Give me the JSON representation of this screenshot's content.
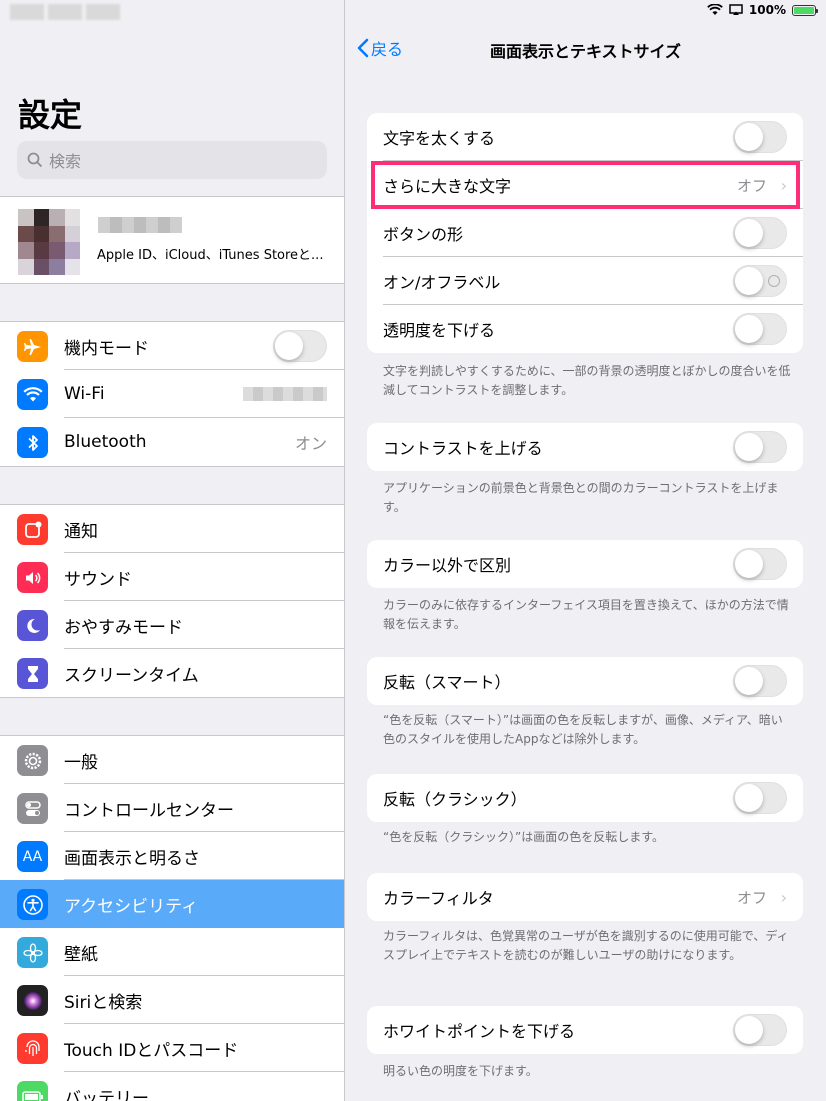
{
  "status": {
    "battery": "100%"
  },
  "sidebar": {
    "title": "設定",
    "search_placeholder": "検索",
    "profile_sub": "Apple ID、iCloud、iTunes Storeと...",
    "group1": [
      {
        "label": "機内モード",
        "icon": "airplane-icon",
        "color": "#ff9500",
        "type": "toggle"
      },
      {
        "label": "Wi-Fi",
        "icon": "wifi-icon",
        "color": "#007aff",
        "type": "blur"
      },
      {
        "label": "Bluetooth",
        "icon": "bluetooth-icon",
        "color": "#007aff",
        "value": "オン"
      }
    ],
    "group2": [
      {
        "label": "通知",
        "icon": "notification-icon",
        "color": "#ff3b30"
      },
      {
        "label": "サウンド",
        "icon": "speaker-icon",
        "color": "#ff2d55"
      },
      {
        "label": "おやすみモード",
        "icon": "moon-icon",
        "color": "#5856d6"
      },
      {
        "label": "スクリーンタイム",
        "icon": "hourglass-icon",
        "color": "#5856d6"
      }
    ],
    "group3": [
      {
        "label": "一般",
        "icon": "gear-icon",
        "color": "#8e8e93"
      },
      {
        "label": "コントロールセンター",
        "icon": "switches-icon",
        "color": "#8e8e93"
      },
      {
        "label": "画面表示と明るさ",
        "icon": "text-size-icon",
        "color": "#007aff"
      },
      {
        "label": "アクセシビリティ",
        "icon": "accessibility-icon",
        "color": "#007aff",
        "selected": true
      },
      {
        "label": "壁紙",
        "icon": "flower-icon",
        "color": "#34aadc"
      },
      {
        "label": "Siriと検索",
        "icon": "siri-icon",
        "color": "#222222"
      },
      {
        "label": "Touch IDとパスコード",
        "icon": "fingerprint-icon",
        "color": "#ff3b30"
      },
      {
        "label": "バッテリー",
        "icon": "battery-icon",
        "color": "#4cd964"
      }
    ]
  },
  "main": {
    "back_label": "戻る",
    "title": "画面表示とテキストサイズ",
    "sections": [
      {
        "rows": [
          {
            "label": "文字を太くする",
            "type": "toggle"
          },
          {
            "label": "さらに大きな文字",
            "type": "value",
            "value": "オフ"
          },
          {
            "label": "ボタンの形",
            "type": "toggle"
          },
          {
            "label": "オン/オフラベル",
            "type": "toggle-label"
          },
          {
            "label": "透明度を下げる",
            "type": "toggle"
          }
        ],
        "footer": "文字を判読しやすくするために、一部の背景の透明度とぼかしの度合いを低減してコントラストを調整します。"
      },
      {
        "rows": [
          {
            "label": "コントラストを上げる",
            "type": "toggle"
          }
        ],
        "footer": "アプリケーションの前景色と背景色との間のカラーコントラストを上げます。"
      },
      {
        "rows": [
          {
            "label": "カラー以外で区別",
            "type": "toggle"
          }
        ],
        "footer": "カラーのみに依存するインターフェイス項目を置き換えて、ほかの方法で情報を伝えます。"
      },
      {
        "rows": [
          {
            "label": "反転（スマート）",
            "type": "toggle"
          }
        ],
        "footer": "“色を反転（スマート）”は画面の色を反転しますが、画像、メディア、暗い色のスタイルを使用したAppなどは除外します。"
      },
      {
        "rows": [
          {
            "label": "反転（クラシック）",
            "type": "toggle"
          }
        ],
        "footer": "“色を反転（クラシック）”は画面の色を反転します。"
      },
      {
        "rows": [
          {
            "label": "カラーフィルタ",
            "type": "value",
            "value": "オフ"
          }
        ],
        "footer": "カラーフィルタは、色覚異常のユーザが色を識別するのに使用可能で、ディスプレイ上でテキストを読むのが難しいユーザの助けになります。"
      },
      {
        "rows": [
          {
            "label": "ホワイトポイントを下げる",
            "type": "toggle"
          }
        ],
        "footer": "明るい色の明度を下げます。"
      }
    ]
  }
}
